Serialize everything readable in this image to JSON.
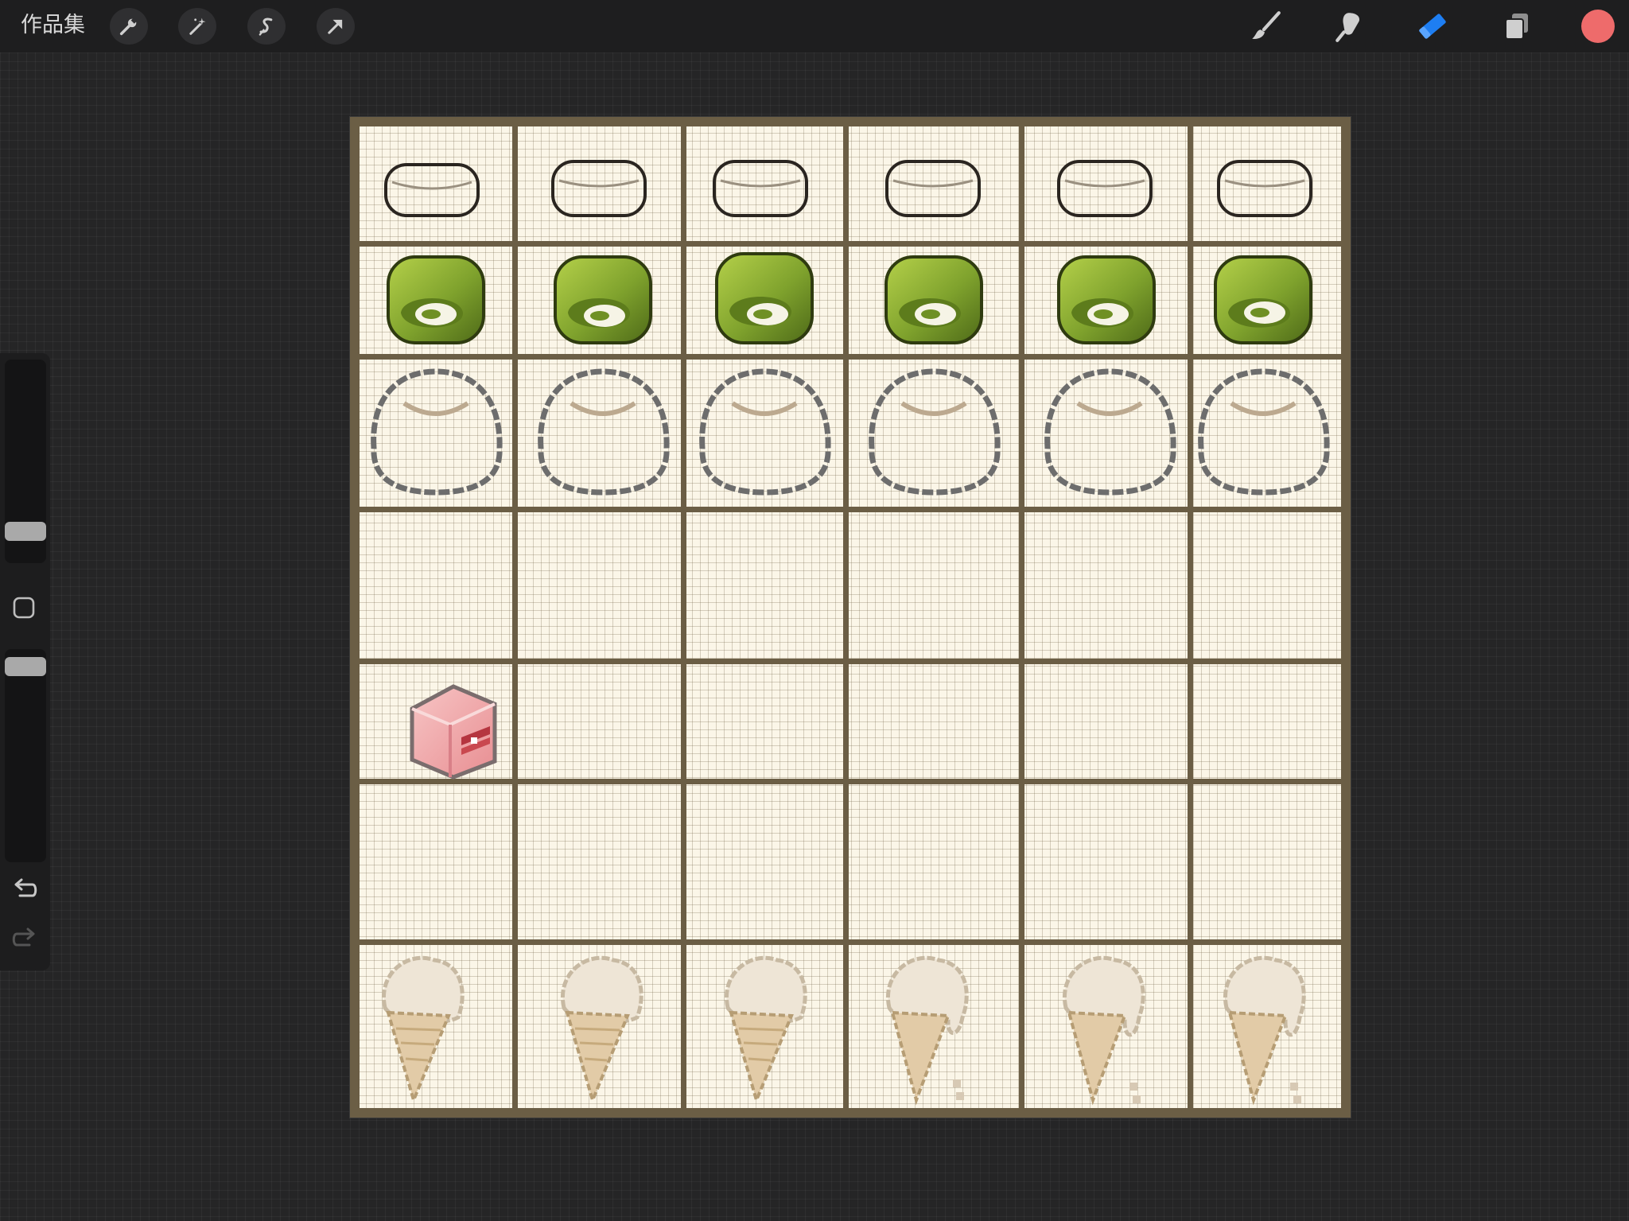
{
  "app": {
    "gallery_label": "作品集"
  },
  "toolbar": {
    "left_tools": [
      {
        "name": "actions",
        "icon": "wrench-icon"
      },
      {
        "name": "adjustments",
        "icon": "magic-wand-icon"
      },
      {
        "name": "selection",
        "icon": "selection-s-icon"
      },
      {
        "name": "transform",
        "icon": "arrow-cursor-icon"
      }
    ],
    "right_tools": [
      {
        "name": "brush",
        "icon": "brush-icon",
        "active": false
      },
      {
        "name": "smudge",
        "icon": "smudge-icon",
        "active": false
      },
      {
        "name": "eraser",
        "icon": "eraser-icon",
        "active": true
      },
      {
        "name": "layers",
        "icon": "layers-icon",
        "active": false
      }
    ],
    "current_color": "#ee6b6b",
    "active_tool_color": "#1e7ef2"
  },
  "sidebar": {
    "brush_size_level": 0.12,
    "opacity_level": 0.96,
    "controls": [
      "brush-size-slider",
      "modify-button",
      "opacity-slider",
      "undo-button",
      "redo-button"
    ]
  },
  "canvas": {
    "background": "#fbf6e8",
    "frame_color": "#6b5e45",
    "rows": [
      {
        "name": "rice-cake-outline",
        "cells": 6
      },
      {
        "name": "green-roll-cake",
        "cells": 6
      },
      {
        "name": "mochi-outline",
        "cells": 6
      },
      {
        "name": "empty",
        "cells": 6
      },
      {
        "name": "pink-jelly-cube",
        "cells": 1
      },
      {
        "name": "empty",
        "cells": 6
      },
      {
        "name": "melting-ice-cream",
        "cells": 6
      }
    ]
  }
}
